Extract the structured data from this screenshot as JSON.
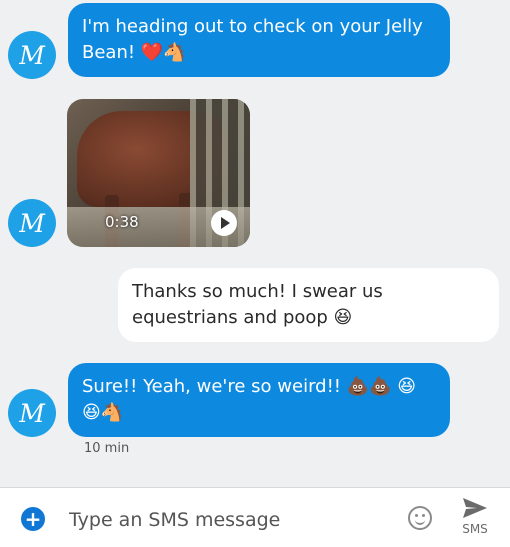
{
  "contact": {
    "initial": "M"
  },
  "messages": [
    {
      "direction": "incoming",
      "text": "I'm heading out to check on your Jelly Bean! ❤️🐴"
    },
    {
      "direction": "incoming",
      "type": "video",
      "duration": "0:38"
    },
    {
      "direction": "outgoing",
      "text": "Thanks so much! I swear us equestrians and poop 😆"
    },
    {
      "direction": "incoming",
      "text": "Sure!! Yeah, we're so weird!! 💩💩 😆 😆🐴",
      "timestamp": "10 min"
    }
  ],
  "composer": {
    "placeholder": "Type an SMS message",
    "send_label": "SMS"
  },
  "colors": {
    "incoming_bubble": "#0d8ae0",
    "avatar": "#1ea1e6",
    "outgoing_bubble": "#ffffff",
    "background": "#eef0f2"
  },
  "icons": [
    "plus-icon",
    "emoji-icon",
    "send-icon",
    "play-icon"
  ]
}
